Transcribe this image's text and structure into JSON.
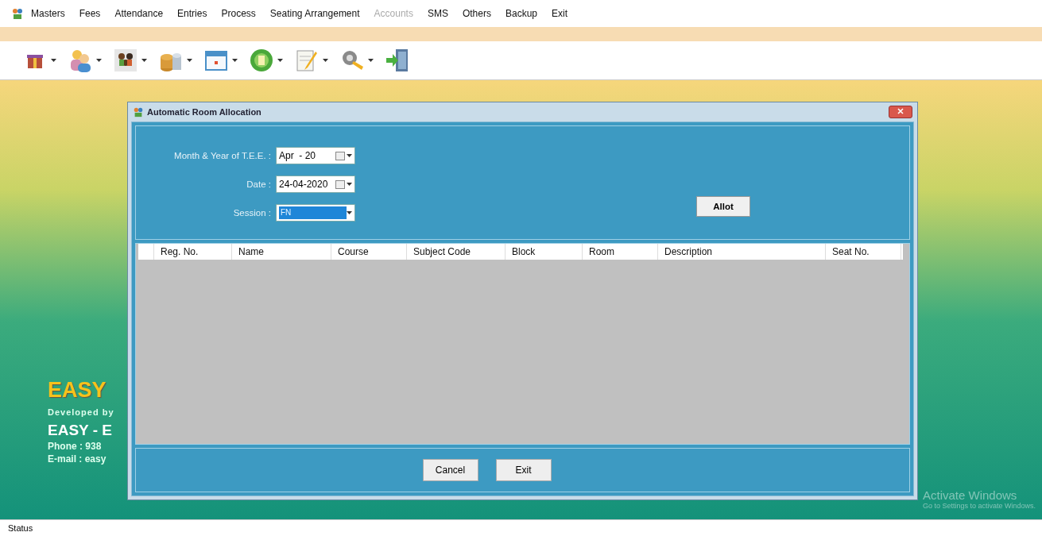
{
  "menu": [
    {
      "label": "Masters",
      "disabled": false
    },
    {
      "label": "Fees",
      "disabled": false
    },
    {
      "label": "Attendance",
      "disabled": false
    },
    {
      "label": "Entries",
      "disabled": false
    },
    {
      "label": "Process",
      "disabled": false
    },
    {
      "label": "Seating Arrangement",
      "disabled": false
    },
    {
      "label": "Accounts",
      "disabled": true
    },
    {
      "label": "SMS",
      "disabled": false
    },
    {
      "label": "Others",
      "disabled": false
    },
    {
      "label": "Backup",
      "disabled": false
    },
    {
      "label": "Exit",
      "disabled": false
    }
  ],
  "toolbar": [
    {
      "kind": "gift",
      "dropdown": true
    },
    {
      "kind": "users",
      "dropdown": true
    },
    {
      "kind": "group",
      "dropdown": true
    },
    {
      "kind": "coins",
      "dropdown": true
    },
    {
      "kind": "calendar",
      "dropdown": true
    },
    {
      "kind": "badge",
      "dropdown": true
    },
    {
      "kind": "notepad",
      "dropdown": true
    },
    {
      "kind": "gear",
      "dropdown": true
    },
    {
      "kind": "exit",
      "dropdown": false
    }
  ],
  "branding": {
    "title": "EASY",
    "developed_by": "Developed by",
    "company": "EASY - E",
    "phone": "Phone : 938",
    "email": "E-mail : easy"
  },
  "dialog": {
    "title": "Automatic Room Allocation",
    "fields": [
      {
        "label": "Month & Year of T.E.E. :",
        "value": "Apr  - 20",
        "kind": "date"
      },
      {
        "label": "Date :",
        "value": "24-04-2020",
        "kind": "date"
      },
      {
        "label": "Session :",
        "value": "FN",
        "kind": "combo"
      }
    ],
    "allot_button": "Allot",
    "table": {
      "columns": [
        "Reg. No.",
        "Name",
        "Course",
        "Subject Code",
        "Block",
        "Room",
        "Description",
        "Seat No."
      ]
    },
    "buttons": [
      "Cancel",
      "Exit"
    ]
  },
  "watermark": {
    "title": "Activate Windows",
    "subtitle": "Go to Settings to activate Windows."
  },
  "status_bar": "Status"
}
